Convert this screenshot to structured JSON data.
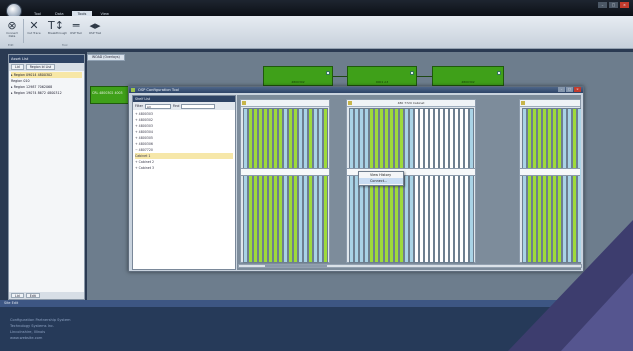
{
  "window": {
    "tabs": [
      "Tool",
      "Data",
      "Tools",
      "View"
    ],
    "active_tab_index": 2,
    "controls": {
      "minimize": "–",
      "maximize": "□",
      "close": "×"
    }
  },
  "ribbon": {
    "items": [
      {
        "label": "Connect Data",
        "icon": "circle-network-icon",
        "glyph": "⊗"
      },
      {
        "label": "Cut Trace",
        "icon": "cut-icon",
        "glyph": "✕"
      },
      {
        "label": "Breakthrough",
        "icon": "text-cursor-icon",
        "glyph": "T↕"
      },
      {
        "label": "OSP Tool",
        "icon": "dash-icon",
        "glyph": "═"
      },
      {
        "label": "OSP Trail",
        "icon": "arrows-icon",
        "glyph": "◂▸"
      }
    ],
    "group_labels": [
      "Edit",
      "Tool"
    ]
  },
  "left_panel": {
    "title": "Asset List",
    "tabs": [
      "Lid",
      "Region Id List"
    ],
    "items": [
      {
        "text": "▸ Region 09014 4800302",
        "selected": true
      },
      {
        "text": "  Region 010",
        "selected": false
      },
      {
        "text": "▸ Region 12987 7062068",
        "selected": false
      },
      {
        "text": "▸ Region 19074 8672 4800312",
        "selected": false
      }
    ],
    "bottom_tabs": [
      "Lid",
      "Edit"
    ]
  },
  "document": {
    "tab_label": "WOAD (Overlays)",
    "side_label": "CRL 4800302 4003",
    "nodes": [
      {
        "label": "4800302"
      },
      {
        "label": "0001 A3"
      },
      {
        "label": "4800302"
      }
    ]
  },
  "dialog": {
    "title": "OSP Configuration Tool",
    "controls": {
      "minimize": "–",
      "maximize": "□",
      "close": "×"
    },
    "tree": {
      "title": "Shelf List",
      "filter_label": "Filter",
      "filter_value": "All",
      "find_label": "Find",
      "rows": [
        {
          "text": "+  4800303",
          "selected": false
        },
        {
          "text": "+  4800302",
          "selected": false
        },
        {
          "text": "+  4800303",
          "selected": false
        },
        {
          "text": "+  4800304",
          "selected": false
        },
        {
          "text": "+  4800305",
          "selected": false
        },
        {
          "text": "+  4800306",
          "selected": false
        },
        {
          "text": "−  4807720",
          "selected": false
        },
        {
          "text": "     Cabinet 1",
          "selected": true
        },
        {
          "text": "  +  Cabinet 2",
          "selected": false
        },
        {
          "text": "  +  Cabinet 3",
          "selected": false
        }
      ]
    },
    "sections": [
      {
        "label": "",
        "columns": [
          "blue",
          "green",
          "green",
          "green",
          "green",
          "green",
          "green",
          "green",
          "blue",
          "green",
          "green",
          "blue",
          "blue",
          "green",
          "blue",
          "blue",
          "green"
        ]
      },
      {
        "label": "480 7720 Cabinet",
        "columns": [
          "blue",
          "blue",
          "blue",
          "blue",
          "green",
          "green",
          "green",
          "green",
          "green",
          "green",
          "green",
          "blue",
          "blue",
          "white",
          "white",
          "white",
          "white",
          "white",
          "white",
          "white",
          "white",
          "white",
          "white",
          "white",
          "blue"
        ]
      },
      {
        "label": "",
        "columns": [
          "blue",
          "green",
          "green",
          "green",
          "green",
          "green",
          "green",
          "green",
          "blue",
          "blue",
          "green",
          "blue"
        ]
      }
    ],
    "context_menu": {
      "items": [
        "View History",
        "Connect..."
      ],
      "highlighted_index": 1
    }
  },
  "status_bar": {
    "text": "Site Edit"
  },
  "info_panel": {
    "lines": [
      "Configuration Partnership System",
      "Technology Systems Inc.",
      "Lincolnshire, Illinois",
      "www.website.com"
    ]
  },
  "colors": {
    "accent_green": "#3fa019",
    "port_green": "#9edb3a",
    "port_blue": "#a9d3e6",
    "status_blue": "#3d5683",
    "corner_purple": "#3d3d6e"
  }
}
